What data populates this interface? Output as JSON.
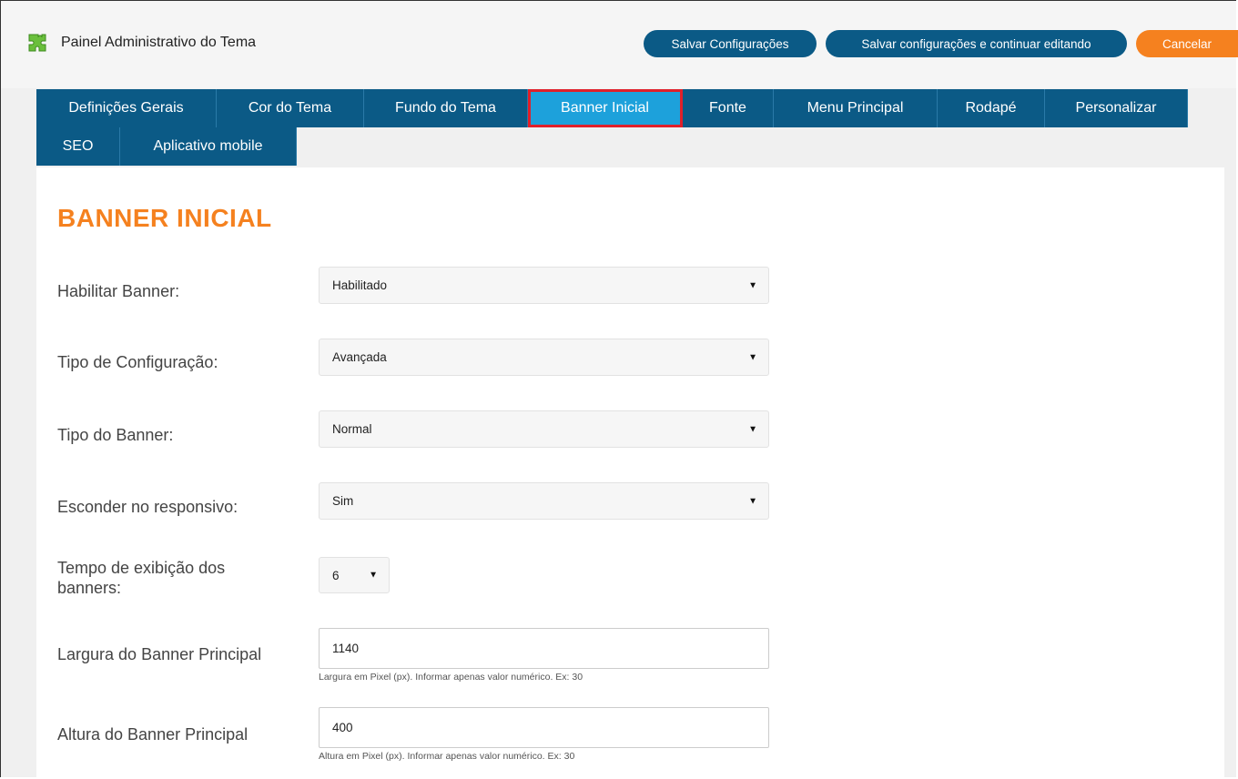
{
  "header": {
    "app_title": "Painel Administrativo do Tema",
    "buttons": {
      "save": "Salvar Configurações",
      "save_continue": "Salvar configurações e continuar editando",
      "cancel": "Cancelar"
    }
  },
  "tabs": [
    {
      "label": "Definições Gerais"
    },
    {
      "label": "Cor do Tema"
    },
    {
      "label": "Fundo do Tema"
    },
    {
      "label": "Banner Inicial",
      "active": true
    },
    {
      "label": "Fonte"
    },
    {
      "label": "Menu Principal"
    },
    {
      "label": "Rodapé"
    },
    {
      "label": "Personalizar"
    },
    {
      "label": "SEO"
    },
    {
      "label": "Aplicativo mobile"
    }
  ],
  "section": {
    "title": "BANNER INICIAL"
  },
  "form": {
    "habilitar_banner": {
      "label": "Habilitar Banner:",
      "value": "Habilitado"
    },
    "tipo_configuracao": {
      "label": "Tipo de Configuração:",
      "value": "Avançada"
    },
    "tipo_banner": {
      "label": "Tipo do Banner:",
      "value": "Normal"
    },
    "esconder_responsivo": {
      "label": "Esconder no responsivo:",
      "value": "Sim"
    },
    "tempo_exibicao": {
      "label_line1": "Tempo de exibição dos",
      "label_line2": "banners:",
      "value": "6"
    },
    "largura_banner": {
      "label": "Largura do Banner Principal",
      "value": "1140",
      "hint": "Largura em Pixel (px). Informar apenas valor numérico. Ex: 30"
    },
    "altura_banner": {
      "label": "Altura do Banner Principal",
      "value": "400",
      "hint": "Altura em Pixel (px). Informar apenas valor numérico. Ex: 30"
    }
  },
  "colors": {
    "tab_bg": "#0b5a86",
    "tab_active_bg": "#1da1db",
    "accent_orange": "#f5811f",
    "highlight_red": "#e0202a"
  },
  "icons": {
    "app_logo": "puzzle-icon",
    "select_caret": "caret-down-icon"
  }
}
